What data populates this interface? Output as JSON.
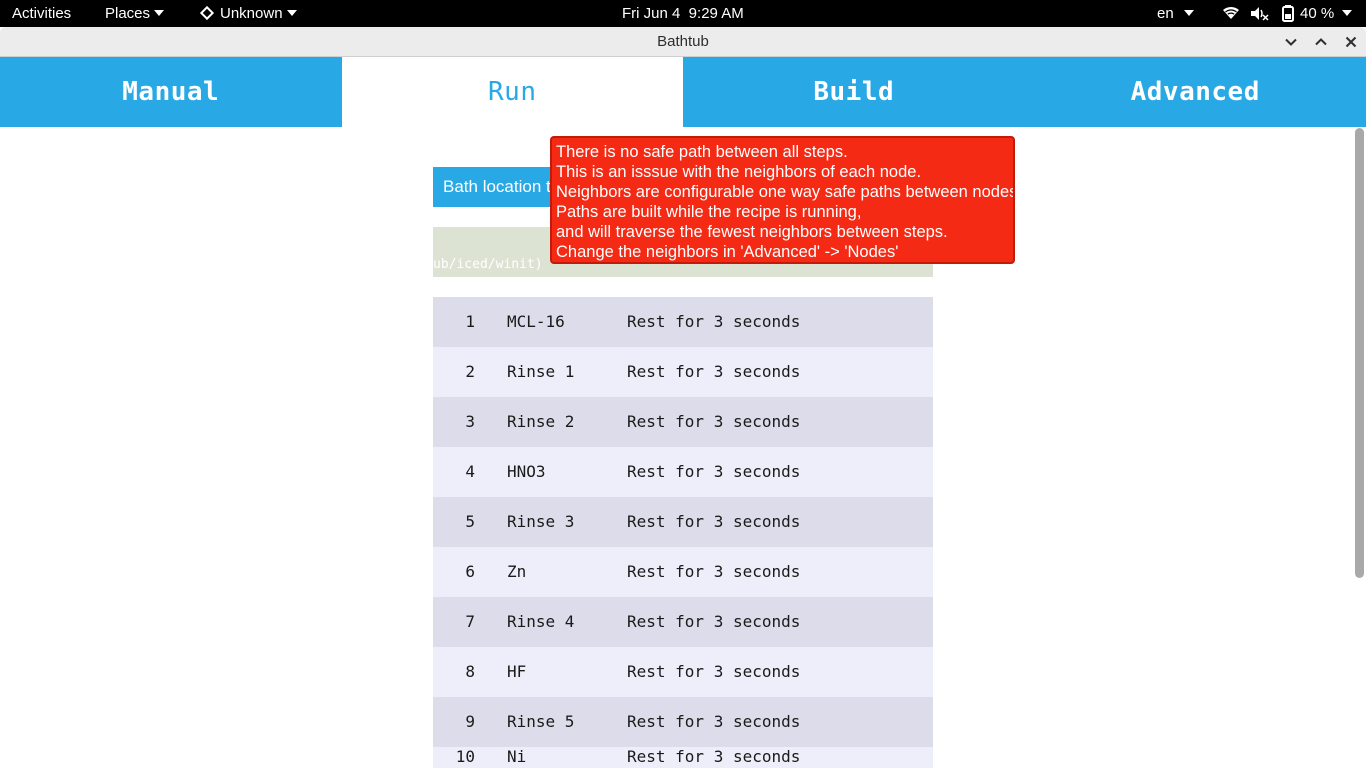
{
  "topbar": {
    "activities": "Activities",
    "places": "Places",
    "app_menu": "Unknown",
    "clock": "Fri Jun 4  9:29 AM",
    "language": "en",
    "battery": "40 %"
  },
  "window": {
    "title": "Bathtub"
  },
  "tabs": [
    {
      "label": "Manual",
      "active": false
    },
    {
      "label": "Run",
      "active": true
    },
    {
      "label": "Build",
      "active": false
    },
    {
      "label": "Advanced",
      "active": false
    }
  ],
  "main": {
    "bath_button_label": "Bath location t",
    "message_text": "ub/iced/winit)"
  },
  "tooltip": {
    "lines": [
      "There is no safe path between all steps.",
      "This is an isssue with the neighbors of each node.",
      "Neighbors are configurable one way safe paths between nodes.",
      "Paths are built while the recipe is running,",
      "and will traverse the fewest neighbors between steps.",
      "Change the neighbors in 'Advanced' -> 'Nodes'"
    ]
  },
  "steps": [
    {
      "num": "1",
      "name": "MCL-16",
      "action": "Rest for 3 seconds"
    },
    {
      "num": "2",
      "name": "Rinse 1",
      "action": "Rest for 3 seconds"
    },
    {
      "num": "3",
      "name": "Rinse 2",
      "action": "Rest for 3 seconds"
    },
    {
      "num": "4",
      "name": "HNO3",
      "action": "Rest for 3 seconds"
    },
    {
      "num": "5",
      "name": "Rinse 3",
      "action": "Rest for 3 seconds"
    },
    {
      "num": "6",
      "name": "Zn",
      "action": "Rest for 3 seconds"
    },
    {
      "num": "7",
      "name": "Rinse 4",
      "action": "Rest for 3 seconds"
    },
    {
      "num": "8",
      "name": "HF",
      "action": "Rest for 3 seconds"
    },
    {
      "num": "9",
      "name": "Rinse 5",
      "action": "Rest for 3 seconds"
    },
    {
      "num": "10",
      "name": "Ni",
      "action": "Rest for 3 seconds"
    }
  ],
  "colors": {
    "accent": "#29a8e6",
    "tooltip_bg": "#f42a15",
    "row_odd": "#dcdcea",
    "row_even": "#eeeefa"
  },
  "icons": [
    "app-diamond-icon",
    "wifi-icon",
    "volume-muted-icon",
    "battery-icon",
    "minimize-icon",
    "maximize-icon",
    "close-icon"
  ]
}
